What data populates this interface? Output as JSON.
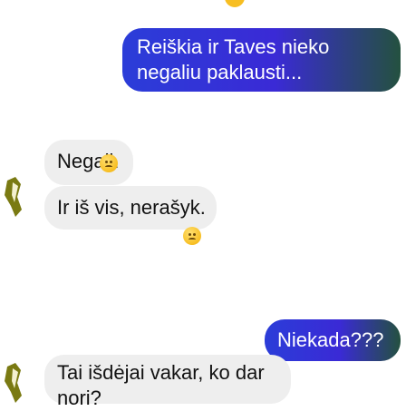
{
  "messages": [
    {
      "direction": "outgoing",
      "text": "Reiškia ir Taves nieko negaliu paklausti..."
    },
    {
      "direction": "incoming",
      "text": "Negali.",
      "reaction": "sad-face-emoji"
    },
    {
      "direction": "incoming",
      "text": "Ir iš vis, nerašyk.",
      "reaction": "sad-face-emoji"
    },
    {
      "direction": "outgoing",
      "text": "Niekada???"
    },
    {
      "direction": "incoming",
      "text": "Tai išdėjai vakar, ko dar nori?"
    }
  ],
  "colors": {
    "outgoing_start": "#2b3dd8",
    "outgoing_end": "#24513f",
    "incoming_bg": "#eeeeee",
    "avatar_mark": "#7a7a12"
  }
}
